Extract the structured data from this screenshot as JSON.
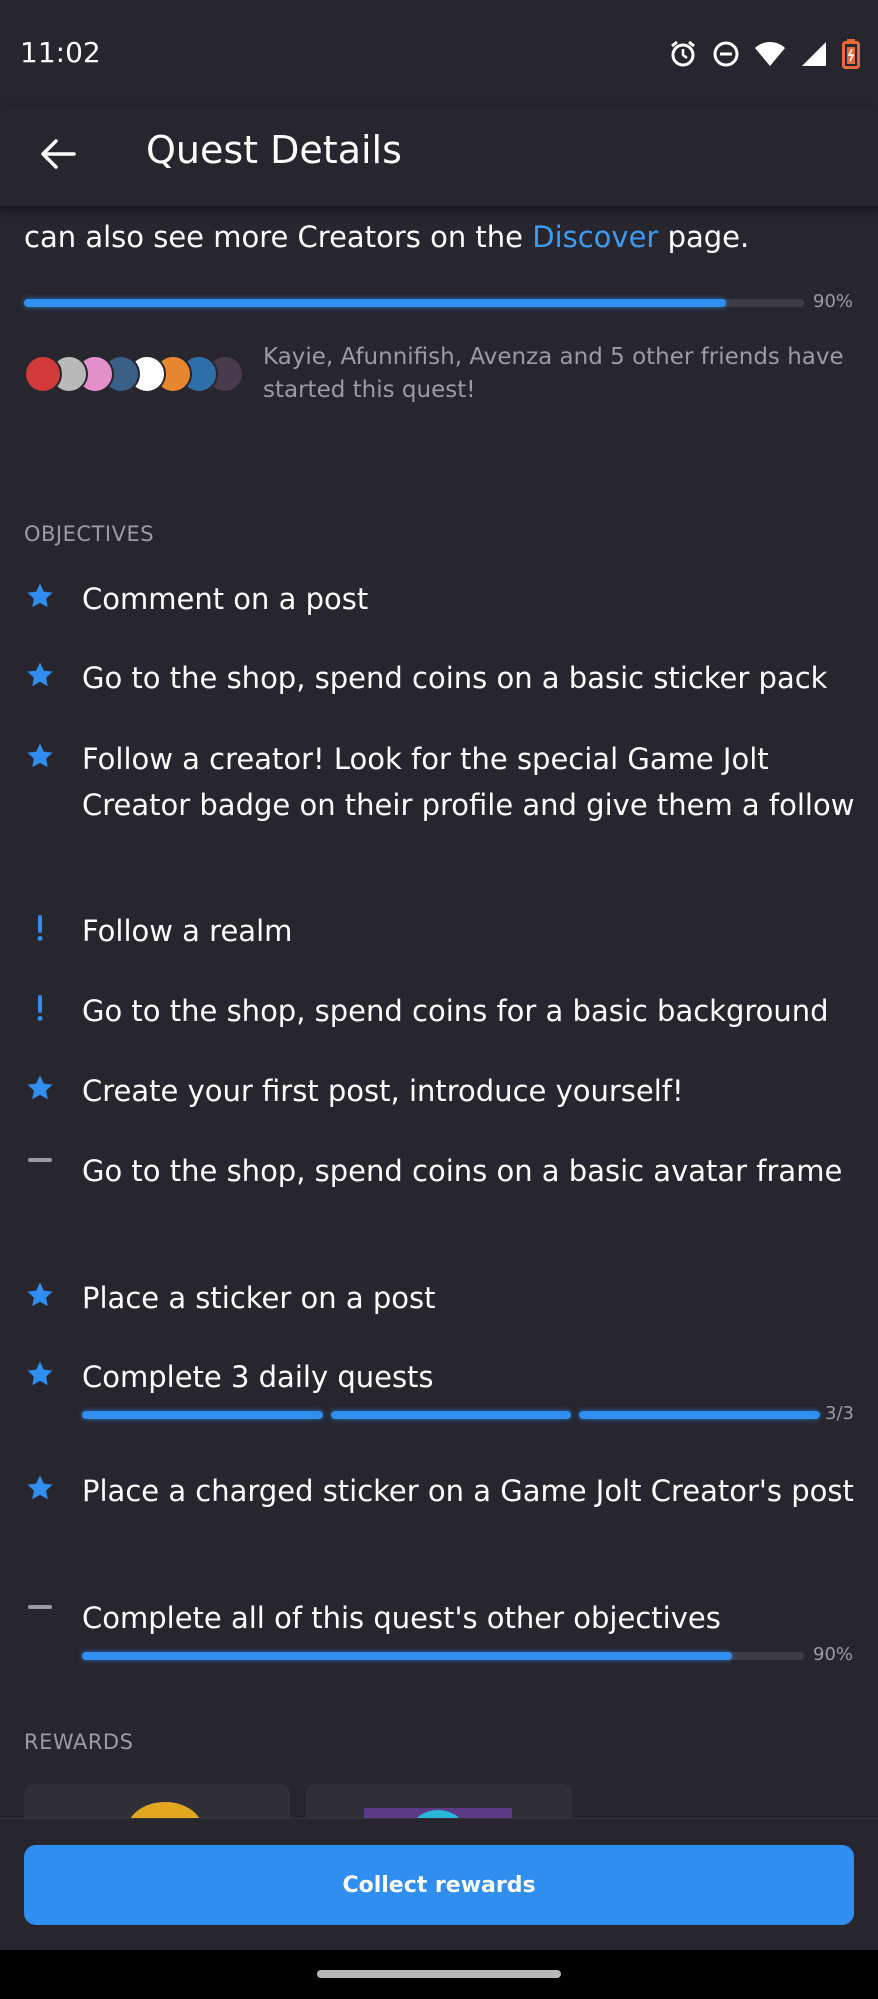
{
  "status_bar": {
    "time": "11:02"
  },
  "app_bar": {
    "title": "Quest Details"
  },
  "intro": {
    "text_before": "can also see more Creators on the ",
    "link_text": "Discover",
    "text_after": " page."
  },
  "quest_progress": {
    "percent_label": "90%",
    "fraction": 0.9
  },
  "friends": {
    "text": "Kayie, Afunnifish, Avenza and 5 other friends have started this quest!",
    "avatar_colors": [
      "#d23a3a",
      "#b9b9b9",
      "#e38fc9",
      "#3a5f86",
      "#ffffff",
      "#e6872f",
      "#2e6fa8",
      "#4a3a4e"
    ]
  },
  "objectives_header": "OBJECTIVES",
  "objectives": [
    {
      "icon": "star-icon",
      "text": "Comment on a post"
    },
    {
      "icon": "star-icon",
      "text": "Go to the shop, spend coins on a basic sticker pack"
    },
    {
      "icon": "star-icon",
      "text": "Follow a creator! Look for the special Game Jolt Creator badge on their profile and give them a follow"
    },
    {
      "icon": "exclamation-icon",
      "text": "Follow a realm"
    },
    {
      "icon": "exclamation-icon",
      "text": "Go to the shop, spend coins for a basic background"
    },
    {
      "icon": "star-icon",
      "text": "Create your first post, introduce yourself!"
    },
    {
      "icon": "dash-icon",
      "text": "Go to the shop, spend coins on a basic avatar frame"
    },
    {
      "icon": "star-icon",
      "text": "Place a sticker on a post"
    },
    {
      "icon": "star-icon",
      "text": "Complete 3 daily quests",
      "progress_label": "3/3",
      "segments_done": 3,
      "segments_total": 3
    },
    {
      "icon": "star-icon",
      "text": "Place a charged sticker on a Game Jolt Creator's post"
    },
    {
      "icon": "dash-icon",
      "text": "Complete all of this quest's other objectives",
      "progress_label": "90%",
      "fraction": 0.9
    }
  ],
  "rewards_header": "REWARDS",
  "collect_button": "Collect rewards",
  "colors": {
    "background": "#27252d",
    "accent": "#2f8ef0",
    "link": "#3d9bf2",
    "muted": "#9c9aa3"
  }
}
